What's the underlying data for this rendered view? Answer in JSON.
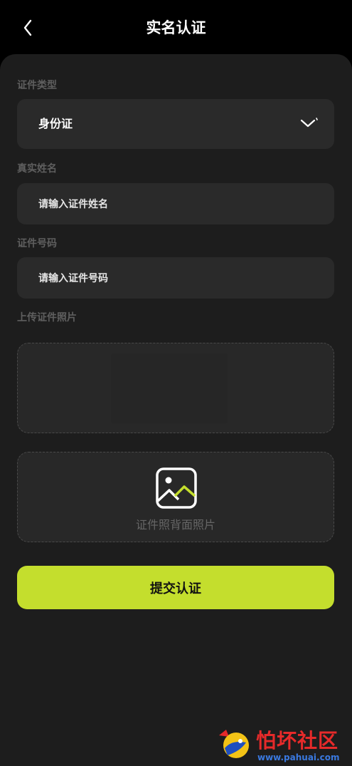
{
  "header": {
    "title": "实名认证",
    "back_icon": "chevron-left-icon"
  },
  "form": {
    "id_type": {
      "label": "证件类型",
      "value": "身份证",
      "arrow_icon": "chevron-down-icon"
    },
    "real_name": {
      "label": "真实姓名",
      "placeholder": "请输入证件姓名"
    },
    "id_number": {
      "label": "证件号码",
      "placeholder": "请输入证件号码"
    },
    "upload": {
      "label": "上传证件照片",
      "back_caption": "证件照背面照片",
      "image_icon": "image-icon"
    },
    "submit_label": "提交认证"
  },
  "watermark": {
    "name": "怕坏社区",
    "url": "www.pahuai.com"
  },
  "colors": {
    "background": "#000000",
    "card": "#1d1d1d",
    "field": "#2a2a2a",
    "accent": "#c4de2d",
    "label": "#5f5f5f"
  }
}
